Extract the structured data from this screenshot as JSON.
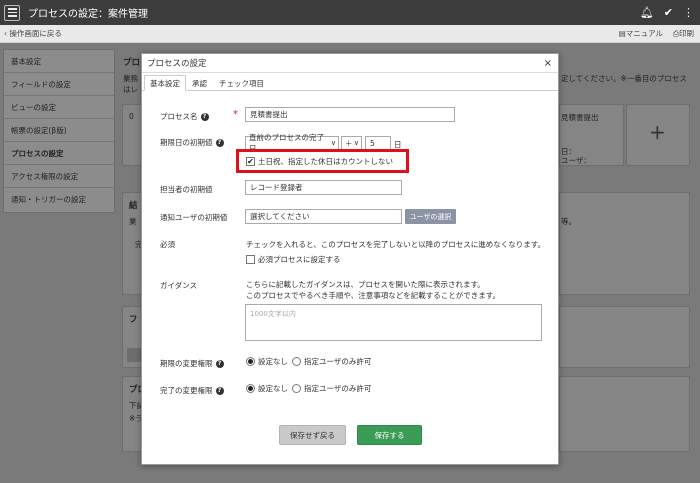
{
  "app": {
    "title": "プロセスの設定：案件管理"
  },
  "subbar": {
    "back": "操作画面に戻る",
    "manual": "マニュアル",
    "print": "印刷"
  },
  "sidebar": {
    "items": [
      {
        "label": "基本設定"
      },
      {
        "label": "フィールドの設定"
      },
      {
        "label": "ビューの設定"
      },
      {
        "label": "帳票の設定(β版)"
      },
      {
        "label": "プロセスの設定"
      },
      {
        "label": "アクセス権限の設定"
      },
      {
        "label": "通知・トリガーの設定"
      }
    ]
  },
  "background": {
    "heading_1": "プロ",
    "text_1a": "業務",
    "text_1b": "はレ",
    "text_right": "定してください。※一番目のプロセス",
    "zero": "0",
    "card_title": "見積書提出",
    "card_line1": "日：",
    "card_line2": "ユーザ：",
    "heading_2": "結",
    "text_2a": "業",
    "text_2b": "完",
    "text_right2": "等。",
    "heading_3": "フ",
    "heading_4": "プロ",
    "text_4a": "下記",
    "text_4b": "※ラ"
  },
  "modal": {
    "title": "プロセスの設定",
    "close_symbol": "×",
    "tabs": [
      "基本設定",
      "承認",
      "チェック項目"
    ],
    "process_name": {
      "label": "プロセス名",
      "value": "見積書提出",
      "required_mark": "*"
    },
    "due_date": {
      "label": "期限日の初期値",
      "base_value": "直前のプロセスの完了日",
      "operator_value": "＋",
      "days_value": "5",
      "unit": "日",
      "skip_holidays_label": "土日祝、指定した休日はカウントしない"
    },
    "assignee": {
      "label": "担当者の初期値",
      "value": "レコード登録者"
    },
    "notify": {
      "label": "通知ユーザの初期値",
      "placeholder": "選択してください",
      "select_button": "ユーザの選択"
    },
    "required": {
      "label": "必須",
      "description": "チェックを入れると、このプロセスを完了しないと以降のプロセスに進めなくなります。",
      "checkbox_label": "必須プロセスに設定する"
    },
    "guidance": {
      "label": "ガイダンス",
      "description_1": "こちらに記載したガイダンスは、プロセスを開いた際に表示されます。",
      "description_2": "このプロセスでやるべき手順や、注意事項などを記載することができます。",
      "placeholder": "1000文字以内"
    },
    "due_change": {
      "label": "期限の変更権限",
      "option_none": "設定なし",
      "option_users": "指定ユーザのみ許可"
    },
    "complete_change": {
      "label": "完了の変更権限",
      "option_none": "設定なし",
      "option_users": "指定ユーザのみ許可"
    },
    "buttons": {
      "cancel": "保存せず戻る",
      "save": "保存する"
    }
  }
}
